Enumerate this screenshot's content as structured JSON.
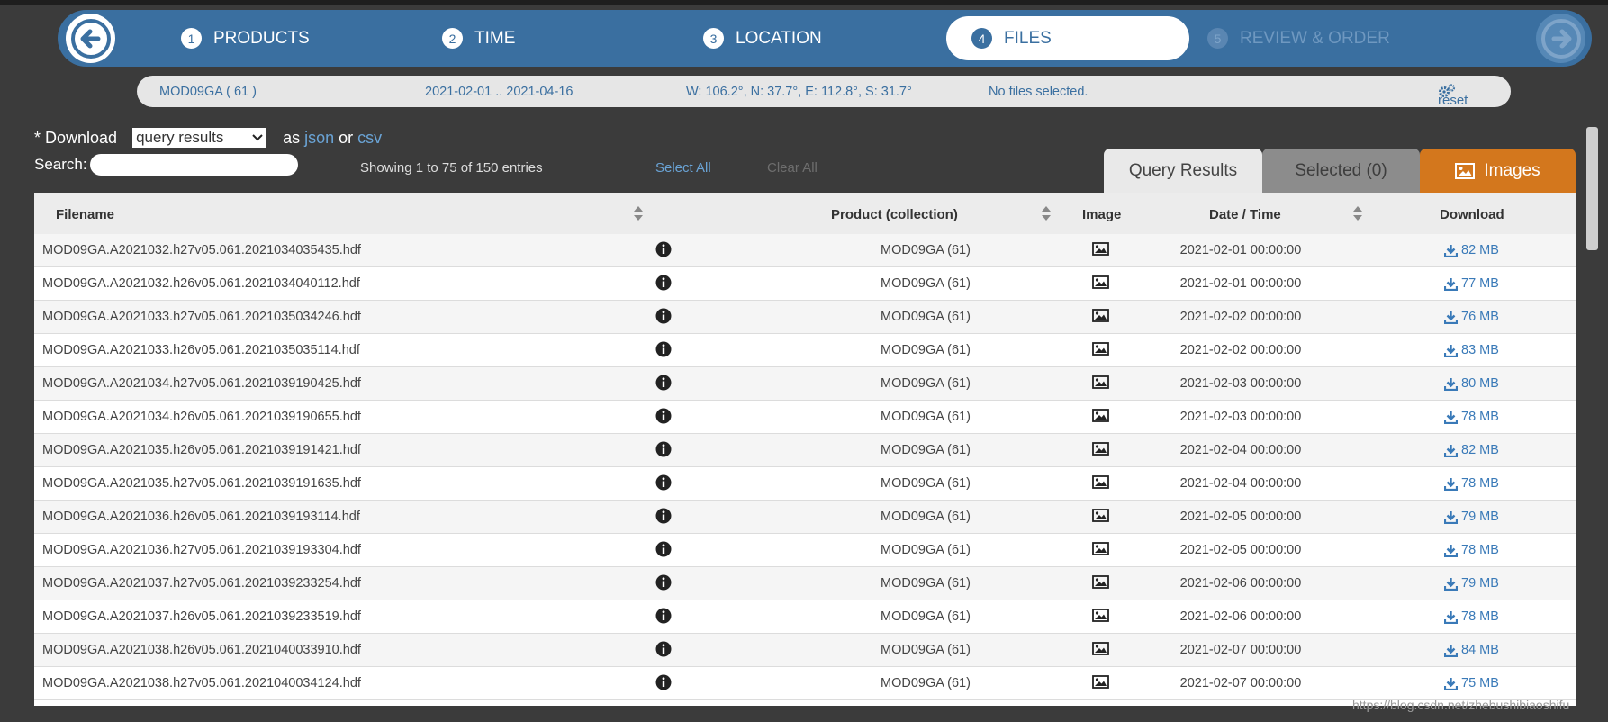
{
  "wizard": {
    "steps": [
      {
        "num": "1",
        "label": "PRODUCTS"
      },
      {
        "num": "2",
        "label": "TIME"
      },
      {
        "num": "3",
        "label": "LOCATION"
      },
      {
        "num": "4",
        "label": "FILES"
      },
      {
        "num": "5",
        "label": "REVIEW & ORDER"
      }
    ],
    "active_step": "FILES"
  },
  "summary": {
    "product": "MOD09GA ( 61 )",
    "dates": "2021-02-01 .. 2021-04-16",
    "location": "W: 106.2°, N: 37.7°, E: 112.8°, S: 31.7°",
    "files": "No files selected.",
    "reset_label": "reset"
  },
  "download": {
    "prefix": "* Download",
    "select_value": "query results",
    "as_label": "as",
    "json_label": "json",
    "or_label": "or",
    "csv_label": "csv"
  },
  "search": {
    "label": "Search:",
    "value": ""
  },
  "showing": "Showing 1 to 75 of 150 entries",
  "select_all": "Select All",
  "clear_all": "Clear All",
  "tabs": {
    "query_results": "Query Results",
    "selected": "Selected (0)",
    "images": "Images"
  },
  "table": {
    "headers": {
      "filename": "Filename",
      "product": "Product (collection)",
      "image": "Image",
      "datetime": "Date / Time",
      "download": "Download"
    },
    "rows": [
      {
        "filename": "MOD09GA.A2021032.h27v05.061.2021034035435.hdf",
        "product": "MOD09GA (61)",
        "datetime": "2021-02-01 00:00:00",
        "size": "82 MB"
      },
      {
        "filename": "MOD09GA.A2021032.h26v05.061.2021034040112.hdf",
        "product": "MOD09GA (61)",
        "datetime": "2021-02-01 00:00:00",
        "size": "77 MB"
      },
      {
        "filename": "MOD09GA.A2021033.h27v05.061.2021035034246.hdf",
        "product": "MOD09GA (61)",
        "datetime": "2021-02-02 00:00:00",
        "size": "76 MB"
      },
      {
        "filename": "MOD09GA.A2021033.h26v05.061.2021035035114.hdf",
        "product": "MOD09GA (61)",
        "datetime": "2021-02-02 00:00:00",
        "size": "83 MB"
      },
      {
        "filename": "MOD09GA.A2021034.h27v05.061.2021039190425.hdf",
        "product": "MOD09GA (61)",
        "datetime": "2021-02-03 00:00:00",
        "size": "80 MB"
      },
      {
        "filename": "MOD09GA.A2021034.h26v05.061.2021039190655.hdf",
        "product": "MOD09GA (61)",
        "datetime": "2021-02-03 00:00:00",
        "size": "78 MB"
      },
      {
        "filename": "MOD09GA.A2021035.h26v05.061.2021039191421.hdf",
        "product": "MOD09GA (61)",
        "datetime": "2021-02-04 00:00:00",
        "size": "82 MB"
      },
      {
        "filename": "MOD09GA.A2021035.h27v05.061.2021039191635.hdf",
        "product": "MOD09GA (61)",
        "datetime": "2021-02-04 00:00:00",
        "size": "78 MB"
      },
      {
        "filename": "MOD09GA.A2021036.h26v05.061.2021039193114.hdf",
        "product": "MOD09GA (61)",
        "datetime": "2021-02-05 00:00:00",
        "size": "79 MB"
      },
      {
        "filename": "MOD09GA.A2021036.h27v05.061.2021039193304.hdf",
        "product": "MOD09GA (61)",
        "datetime": "2021-02-05 00:00:00",
        "size": "78 MB"
      },
      {
        "filename": "MOD09GA.A2021037.h27v05.061.2021039233254.hdf",
        "product": "MOD09GA (61)",
        "datetime": "2021-02-06 00:00:00",
        "size": "79 MB"
      },
      {
        "filename": "MOD09GA.A2021037.h26v05.061.2021039233519.hdf",
        "product": "MOD09GA (61)",
        "datetime": "2021-02-06 00:00:00",
        "size": "78 MB"
      },
      {
        "filename": "MOD09GA.A2021038.h26v05.061.2021040033910.hdf",
        "product": "MOD09GA (61)",
        "datetime": "2021-02-07 00:00:00",
        "size": "84 MB"
      },
      {
        "filename": "MOD09GA.A2021038.h27v05.061.2021040034124.hdf",
        "product": "MOD09GA (61)",
        "datetime": "2021-02-07 00:00:00",
        "size": "75 MB"
      }
    ]
  },
  "watermark": "https://blog.csdn.net/zhebushibiaoshifu",
  "colors": {
    "wizard_blue": "#3a6fa0",
    "images_tab_orange": "#d3771d",
    "link_blue": "#6aa3d5",
    "background": "#3b3b3b"
  },
  "icons": {
    "back": "arrow-left-icon",
    "forward": "arrow-right-icon",
    "reset": "cogs-icon",
    "info": "info-circle-icon",
    "image": "image-icon",
    "download": "download-icon",
    "sort": "sort-icon"
  }
}
